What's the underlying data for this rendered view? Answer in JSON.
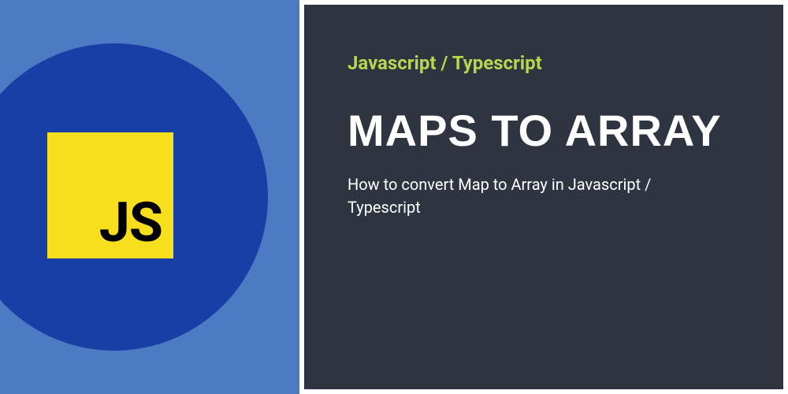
{
  "logo": {
    "badge_text": "JS"
  },
  "content": {
    "category": "Javascript / Typescript",
    "title": "MAPS TO ARRAY",
    "subtitle": "How to convert Map to Array in Javascript / Typescript"
  },
  "colors": {
    "left_bg": "#4c7bc4",
    "circle": "#183fa5",
    "badge": "#f7df1e",
    "right_bg": "#2e3440",
    "accent": "#b7d64f"
  }
}
